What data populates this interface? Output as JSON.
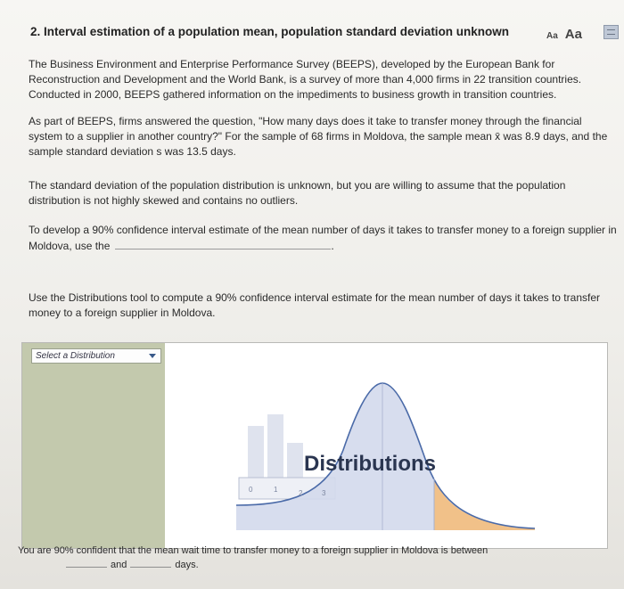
{
  "question": {
    "title": "2. Interval estimation of a population mean, population standard deviation unknown",
    "font_small": "Aa",
    "font_large": "Aa"
  },
  "paragraphs": {
    "p1": "The Business Environment and Enterprise Performance Survey (BEEPS), developed by the European Bank for Reconstruction and Development and the World Bank, is a survey of more than 4,000 firms in 22 transition countries. Conducted in 2000, BEEPS gathered information on the impediments to business growth in transition countries.",
    "p2": "As part of BEEPS, firms answered the question, \"How many days does it take to transfer money through the financial system to a supplier in another country?\" For the sample of 68 firms in Moldova, the sample mean x̄ was 8.9 days, and the sample standard deviation s was 13.5 days.",
    "p3": "The standard deviation of the population distribution is unknown, but you are willing to assume that the population distribution is not highly skewed and contains no outliers.",
    "p4_before": "To develop a 90% confidence interval estimate of the mean number of days it takes to transfer money to a foreign supplier in Moldova, use the",
    "p4_after": ".",
    "p5": "Use the Distributions tool to compute a 90% confidence interval estimate for the mean number of days it takes to transfer money to a foreign supplier in Moldova."
  },
  "tool": {
    "select_label": "Select a Distribution",
    "watermark": "Distributions",
    "axis_ticks": [
      "0",
      "1",
      "2",
      "3"
    ],
    "colors": {
      "left_panel": "#c3c9ad",
      "curve_fill": "#d3d9ec",
      "curve_stroke": "#4a6aa8",
      "tail_fill": "#f1c189",
      "bars": "#dfe3ee"
    }
  },
  "answer": {
    "before": "You are 90% confident that the mean wait time to transfer money to a foreign supplier in Moldova is between",
    "and": "and",
    "days": "days."
  }
}
